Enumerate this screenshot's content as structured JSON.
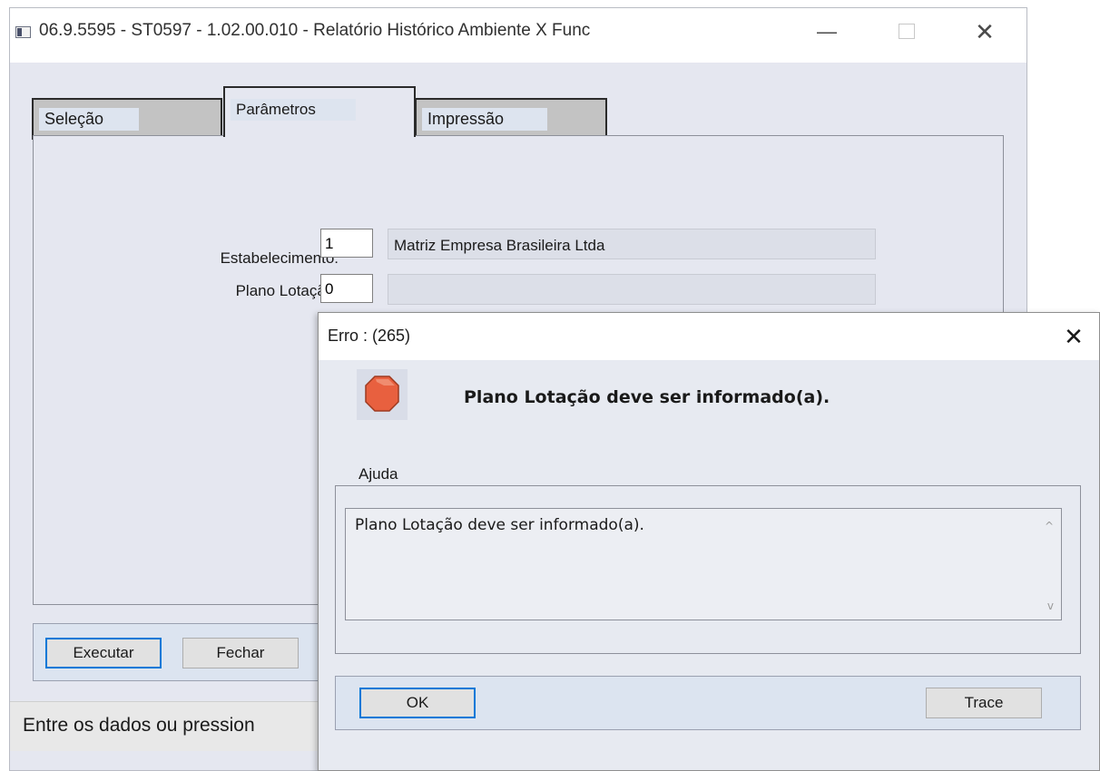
{
  "main_window": {
    "title": "06.9.5595 - ST0597 - 1.02.00.010 - Relatório Histórico Ambiente X Func",
    "window_controls": {
      "minimize_icon": "—",
      "close_icon": "✕"
    },
    "tabs": [
      {
        "label": "Seleção"
      },
      {
        "label": "Parâmetros",
        "selected": true
      },
      {
        "label": "Impressão"
      }
    ],
    "fields": {
      "estabelecimento_label": "Estabelecimento:",
      "estabelecimento_value": "1",
      "estabelecimento_desc": "Matriz Empresa Brasileira Ltda",
      "plano_lotacao_label": "Plano Lotação:",
      "plano_lotacao_value": "0",
      "plano_lotacao_desc": ""
    },
    "buttons": {
      "executar": "Executar",
      "fechar": "Fechar"
    },
    "status_text": "Entre os dados ou pression"
  },
  "error_dialog": {
    "title": "Erro : (265)",
    "close_icon": "✕",
    "icon": "stop-icon",
    "message": "Plano Lotação deve ser informado(a).",
    "help_label": "Ajuda",
    "help_text": "Plano Lotação deve ser informado(a).",
    "scroll_up": "^",
    "scroll_down": "v",
    "buttons": {
      "ok": "OK",
      "trace": "Trace"
    }
  },
  "colors": {
    "window_bg": "#e5e7f0",
    "focus_border": "#0078d7",
    "stop_icon_fill": "#e8603f"
  }
}
